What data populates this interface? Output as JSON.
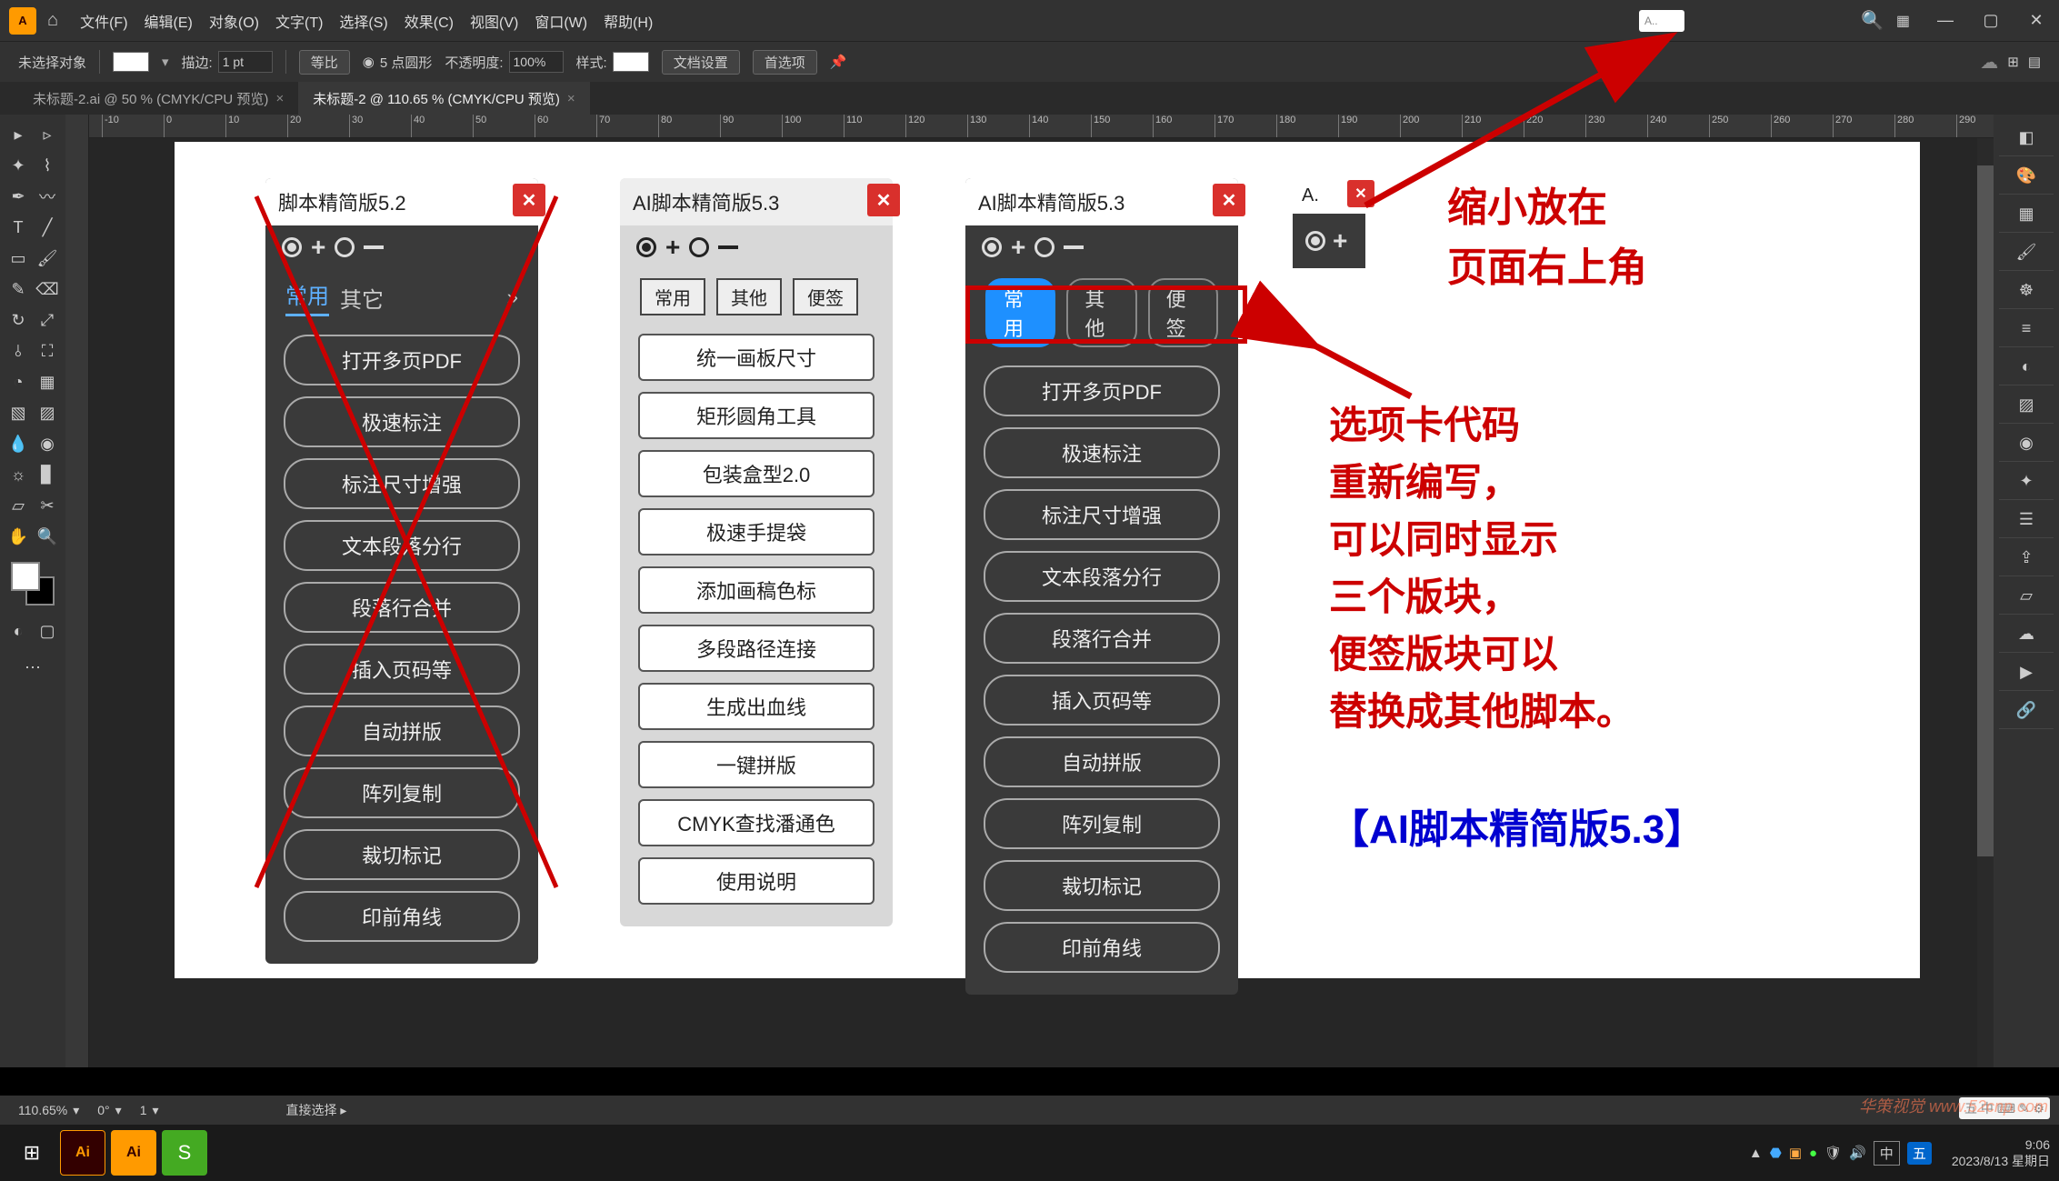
{
  "app": {
    "logo": "A",
    "home": "⌂"
  },
  "menu": [
    "文件(F)",
    "编辑(E)",
    "对象(O)",
    "文字(T)",
    "选择(S)",
    "效果(C)",
    "视图(V)",
    "窗口(W)",
    "帮助(H)"
  ],
  "topbar_search_placeholder": "A..",
  "window_controls": [
    "—",
    "▢",
    "✕"
  ],
  "optbar": {
    "noselect": "未选择对象",
    "stroke_label": "描边:",
    "stroke_value": "1 pt",
    "uniform": "等比",
    "corner_label": "5 点圆形",
    "opacity_label": "不透明度:",
    "opacity_value": "100%",
    "style_label": "样式:",
    "doc_settings": "文档设置",
    "prefs": "首选项"
  },
  "doctabs": [
    {
      "label": "未标题-2.ai @ 50 % (CMYK/CPU 预览)",
      "active": false
    },
    {
      "label": "未标题-2 @ 110.65 % (CMYK/CPU 预览)",
      "active": true
    }
  ],
  "ruler_labels": [
    "-10",
    "0",
    "10",
    "20",
    "30",
    "40",
    "50",
    "60",
    "70",
    "80",
    "90",
    "100",
    "110",
    "120",
    "130",
    "140",
    "150",
    "160",
    "170",
    "180",
    "190",
    "200",
    "210",
    "220",
    "230",
    "240",
    "250",
    "260",
    "270",
    "280",
    "290"
  ],
  "panel1": {
    "title": "脚本精简版5.2",
    "tabs": [
      "常用",
      "其它"
    ],
    "chevron": "»",
    "buttons": [
      "打开多页PDF",
      "极速标注",
      "标注尺寸增强",
      "文本段落分行",
      "段落行合并",
      "插入页码等",
      "自动拼版",
      "阵列复制",
      "裁切标记",
      "印前角线"
    ]
  },
  "panel2": {
    "title": "AI脚本精简版5.3",
    "tabs": [
      "常用",
      "其他",
      "便签"
    ],
    "buttons": [
      "统一画板尺寸",
      "矩形圆角工具",
      "包装盒型2.0",
      "极速手提袋",
      "添加画稿色标",
      "多段路径连接",
      "生成出血线",
      "一键拼版",
      "CMYK查找潘通色",
      "使用说明"
    ]
  },
  "panel3": {
    "title": "AI脚本精简版5.3",
    "tabs": [
      "常用",
      "其他",
      "便签"
    ],
    "buttons": [
      "打开多页PDF",
      "极速标注",
      "标注尺寸增强",
      "文本段落分行",
      "段落行合并",
      "插入页码等",
      "自动拼版",
      "阵列复制",
      "裁切标记",
      "印前角线"
    ]
  },
  "panel4": {
    "title": "A."
  },
  "annotations": {
    "a1_line1": "缩小放在",
    "a1_line2": "页面右上角",
    "a2_line1": "选项卡代码",
    "a2_line2": "重新编写，",
    "a2_line3": "可以同时显示",
    "a2_line4": "三个版块，",
    "a2_line5": "便签版块可以",
    "a2_line6": "替换成其他脚本。",
    "title": "【AI脚本精简版5.3】"
  },
  "statusbar": {
    "zoom": "110.65%",
    "rotate": "0°",
    "artboard": "1",
    "tool": "直接选择"
  },
  "taskbar": {
    "time": "9:06",
    "date": "2023/8/13 星期日",
    "ime": "中",
    "icons": [
      "五",
      "🅰"
    ]
  },
  "watermark": "华策视觉 www.52cnp.com",
  "sys_tray": "五 中 ⌨ ✎ ⚙"
}
